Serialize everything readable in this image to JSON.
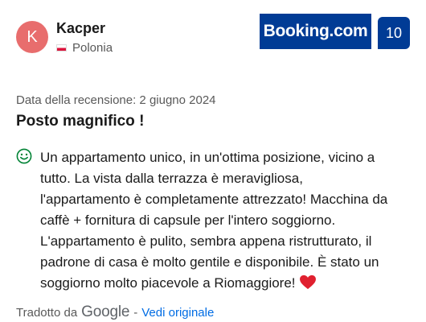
{
  "reviewer": {
    "avatar_initial": "K",
    "name": "Kacper",
    "country": "Polonia"
  },
  "brand": {
    "logo_text": "Booking.com",
    "score": "10",
    "brand_color": "#003b95"
  },
  "review": {
    "date_text": "Data della recensione: 2 giugno 2024",
    "title": "Posto magnifico !",
    "sentiment_icon": "smile-icon",
    "body_lines": [
      "Un appartamento unico, in un'ottima posizione, vicino a",
      "tutto. La vista dalla terrazza è meravigliosa,",
      "l'appartamento è completamente attrezzato! Macchina da",
      "caffè + fornitura di capsule per l'intero soggiorno.",
      "L'appartamento è pulito, sembra appena ristrutturato, il",
      "padrone di casa è molto gentile e disponibile. È stato un",
      "soggiorno molto piacevole a Riomaggiore!"
    ]
  },
  "translation": {
    "prefix": "Tradotto da",
    "provider": "Google",
    "separator": "-",
    "link_label": "Vedi originale",
    "link_color": "#006ce4"
  }
}
